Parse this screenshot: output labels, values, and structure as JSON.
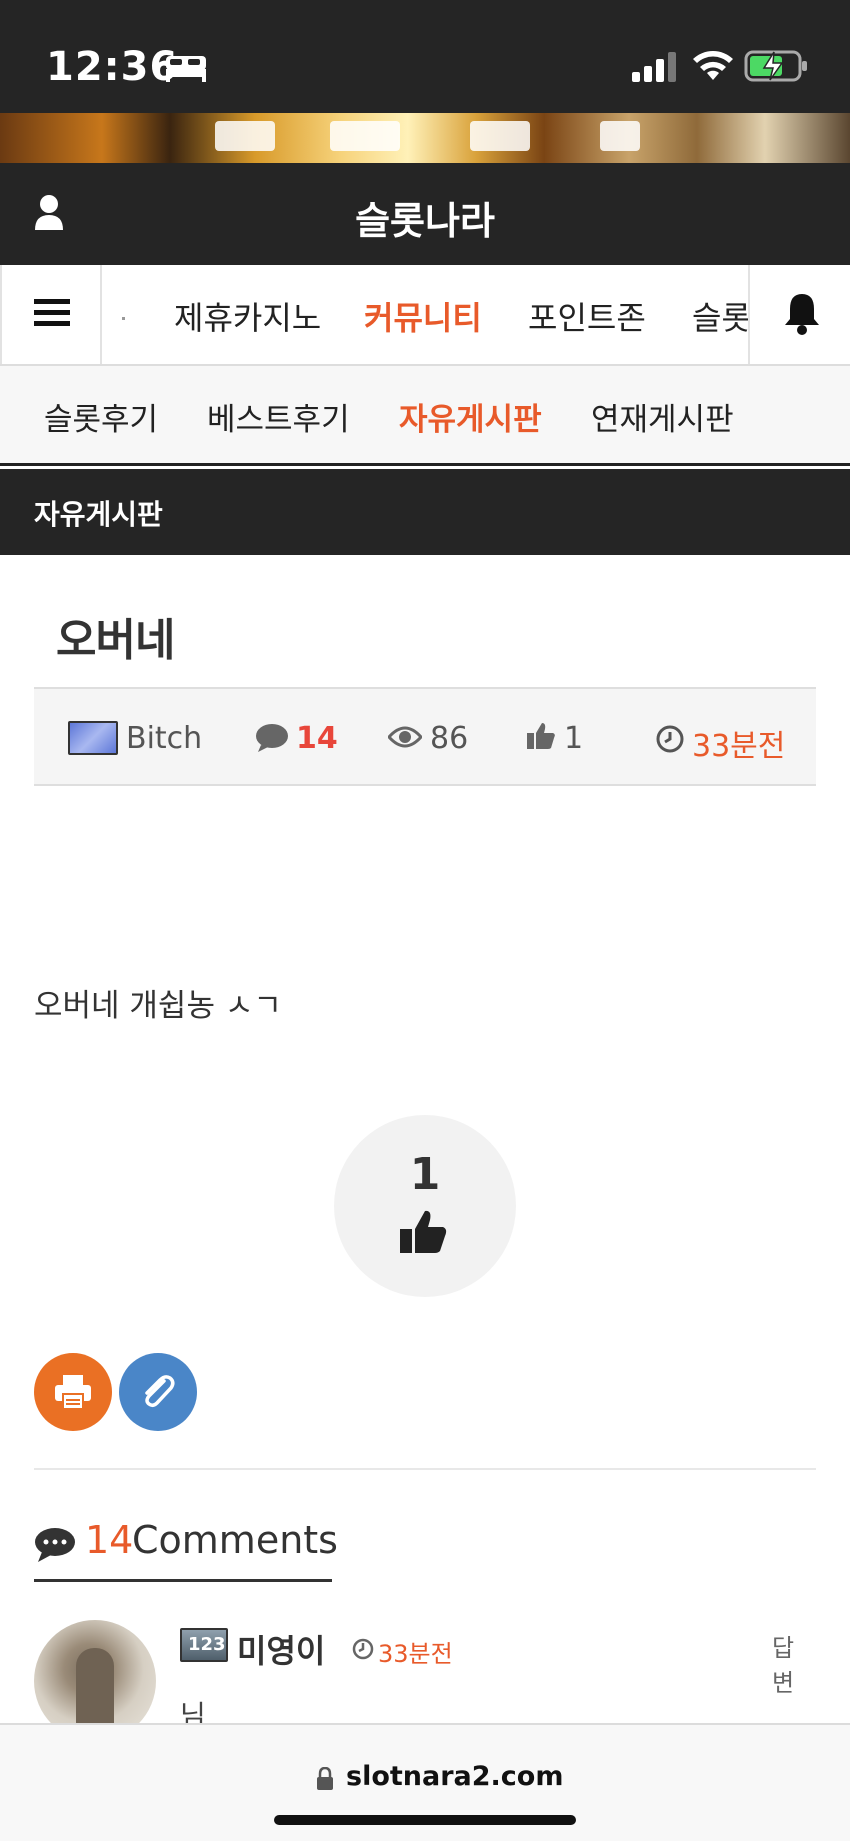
{
  "status_bar": {
    "time": "12:36",
    "battery_charging": true
  },
  "header": {
    "site_title": "슬롯나라"
  },
  "main_nav": {
    "tabs": [
      {
        "label": "제휴카지노",
        "active": false
      },
      {
        "label": "커뮤니티",
        "active": true
      },
      {
        "label": "포인트존",
        "active": false
      },
      {
        "label": "슬롯",
        "active": false
      }
    ]
  },
  "sub_nav": {
    "tabs": [
      {
        "label": "슬롯후기",
        "active": false
      },
      {
        "label": "베스트후기",
        "active": false
      },
      {
        "label": "자유게시판",
        "active": true
      },
      {
        "label": "연재게시판",
        "active": false
      }
    ]
  },
  "board": {
    "title": "자유게시판"
  },
  "post": {
    "title": "오버네",
    "author": "Bitch",
    "comment_count": "14",
    "views": "86",
    "likes": "1",
    "time": "33분전",
    "body": "오버네 개쉽농 ㅅㄱ",
    "like_button_count": "1"
  },
  "comments_section": {
    "count": "14",
    "label": "Comments",
    "items": [
      {
        "author": "미영이",
        "badge": "123",
        "time": "33분전",
        "reply_label": "답변",
        "text": "님"
      }
    ]
  },
  "browser": {
    "url": "slotnara2.com"
  },
  "colors": {
    "accent": "#e85a2a",
    "dark": "#252525",
    "print": "#ea7024",
    "clip": "#4a86c8"
  }
}
